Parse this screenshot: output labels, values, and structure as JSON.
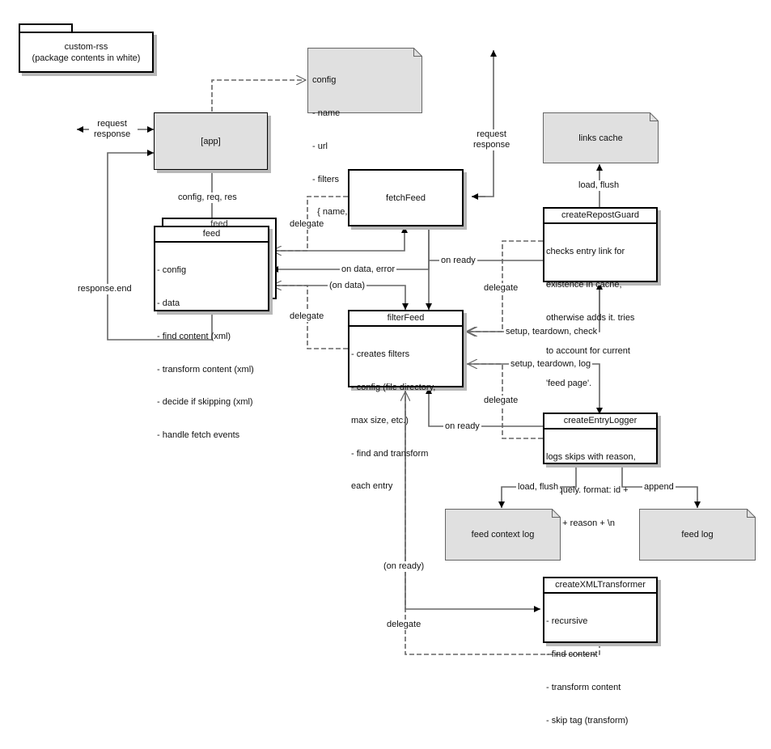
{
  "package": {
    "name": "custom-rss",
    "caption": "(package contents in white)"
  },
  "nodes": {
    "app": {
      "label": "[app]"
    },
    "fetchFeed": {
      "label": "fetchFeed"
    },
    "feed": {
      "title": "feed",
      "shadow_title": "feed",
      "items": [
        "- config",
        "- data",
        "- find content (xml)",
        "- transform content (xml)",
        "- decide if skipping (xml)",
        "- handle fetch events"
      ]
    },
    "filterFeed": {
      "title": "filterFeed",
      "items": [
        "- creates filters",
        "- config (file directory,",
        "max size, etc.)",
        "- find and transform",
        "each entry"
      ]
    },
    "createRepostGuard": {
      "title": "createRepostGuard",
      "items": [
        "checks entry link for",
        "existence in cache,",
        "otherwise adds it. tries",
        "to account for current",
        "'feed page'."
      ]
    },
    "createEntryLogger": {
      "title": "createEntryLogger",
      "items": [
        "logs skips with reason,",
        "uniquely. format: id +",
        "title + reason + \\n"
      ]
    },
    "createXMLTransformer": {
      "title": "createXMLTransformer",
      "items": [
        "- recursive",
        "- find content",
        "- transform content",
        "- skip tag (transform)"
      ]
    }
  },
  "notes": {
    "config": {
      "lines": [
        "config",
        "- name",
        "- url",
        "- filters",
        "  { name, type, tokens }"
      ]
    },
    "links_cache": {
      "label": "links cache"
    },
    "feed_context_log": {
      "label": "feed context log"
    },
    "feed_log": {
      "label": "feed log"
    }
  },
  "edge_labels": {
    "app_io": "request\nresponse",
    "fetch_io": "request\nresponse",
    "app_to_feed": "config, req, res",
    "response_end": "response.end",
    "delegate_fetch": "delegate",
    "on_data_error": "on data, error",
    "on_data_paren": "(on data)",
    "delegate_filter": "delegate",
    "on_ready_fetch": "on ready",
    "delegate_guard": "delegate",
    "setup_check": "setup, teardown, check",
    "setup_log": "setup, teardown, log",
    "delegate_logger": "delegate",
    "on_ready_logger": "on ready",
    "load_flush_cache": "load, flush",
    "load_flush_ctx": "load, flush",
    "append": "append",
    "on_ready_paren": "(on ready)",
    "delegate_xml": "delegate"
  },
  "colors": {
    "node_fill": "#ffffff",
    "external_fill": "#e0e0e0",
    "line": "#666666",
    "shadow": "#b8b8b8"
  }
}
